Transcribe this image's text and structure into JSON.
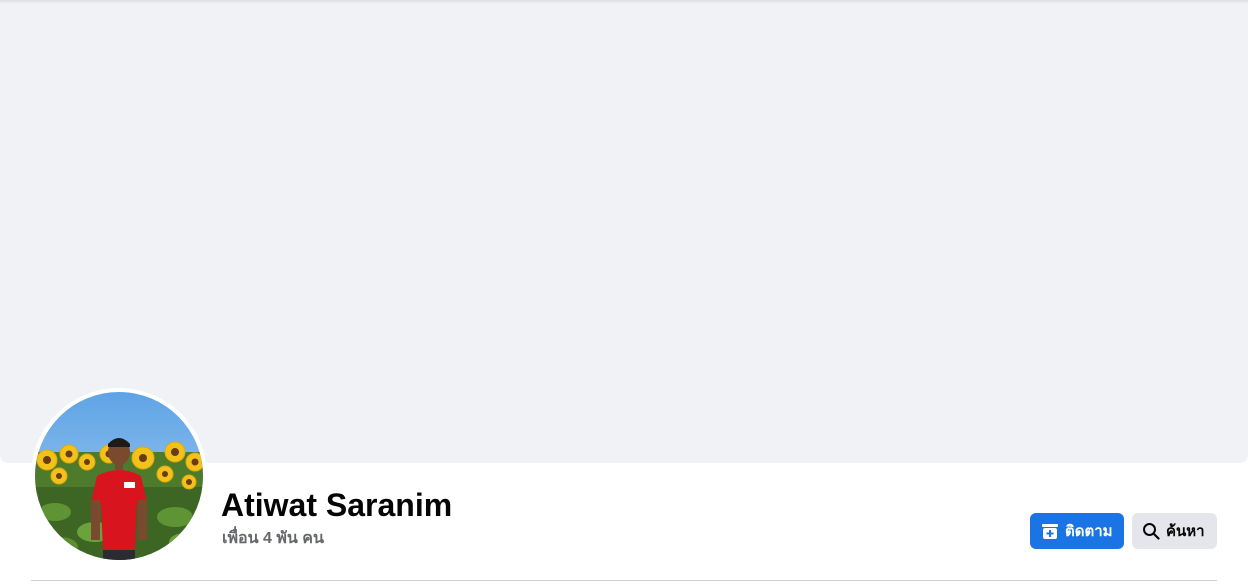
{
  "profile": {
    "name": "Atiwat Saranim",
    "friends_count": "เพื่อน 4 พัน คน"
  },
  "actions": {
    "follow_label": "ติดตาม",
    "search_label": "ค้นหา"
  },
  "icons": {
    "follow": "follow-plus-icon",
    "search": "magnifier-icon"
  },
  "colors": {
    "primary": "#1b74e4",
    "secondary_button": "#e4e6eb",
    "cover_background": "#f0f2f5",
    "muted_text": "#65676b"
  }
}
